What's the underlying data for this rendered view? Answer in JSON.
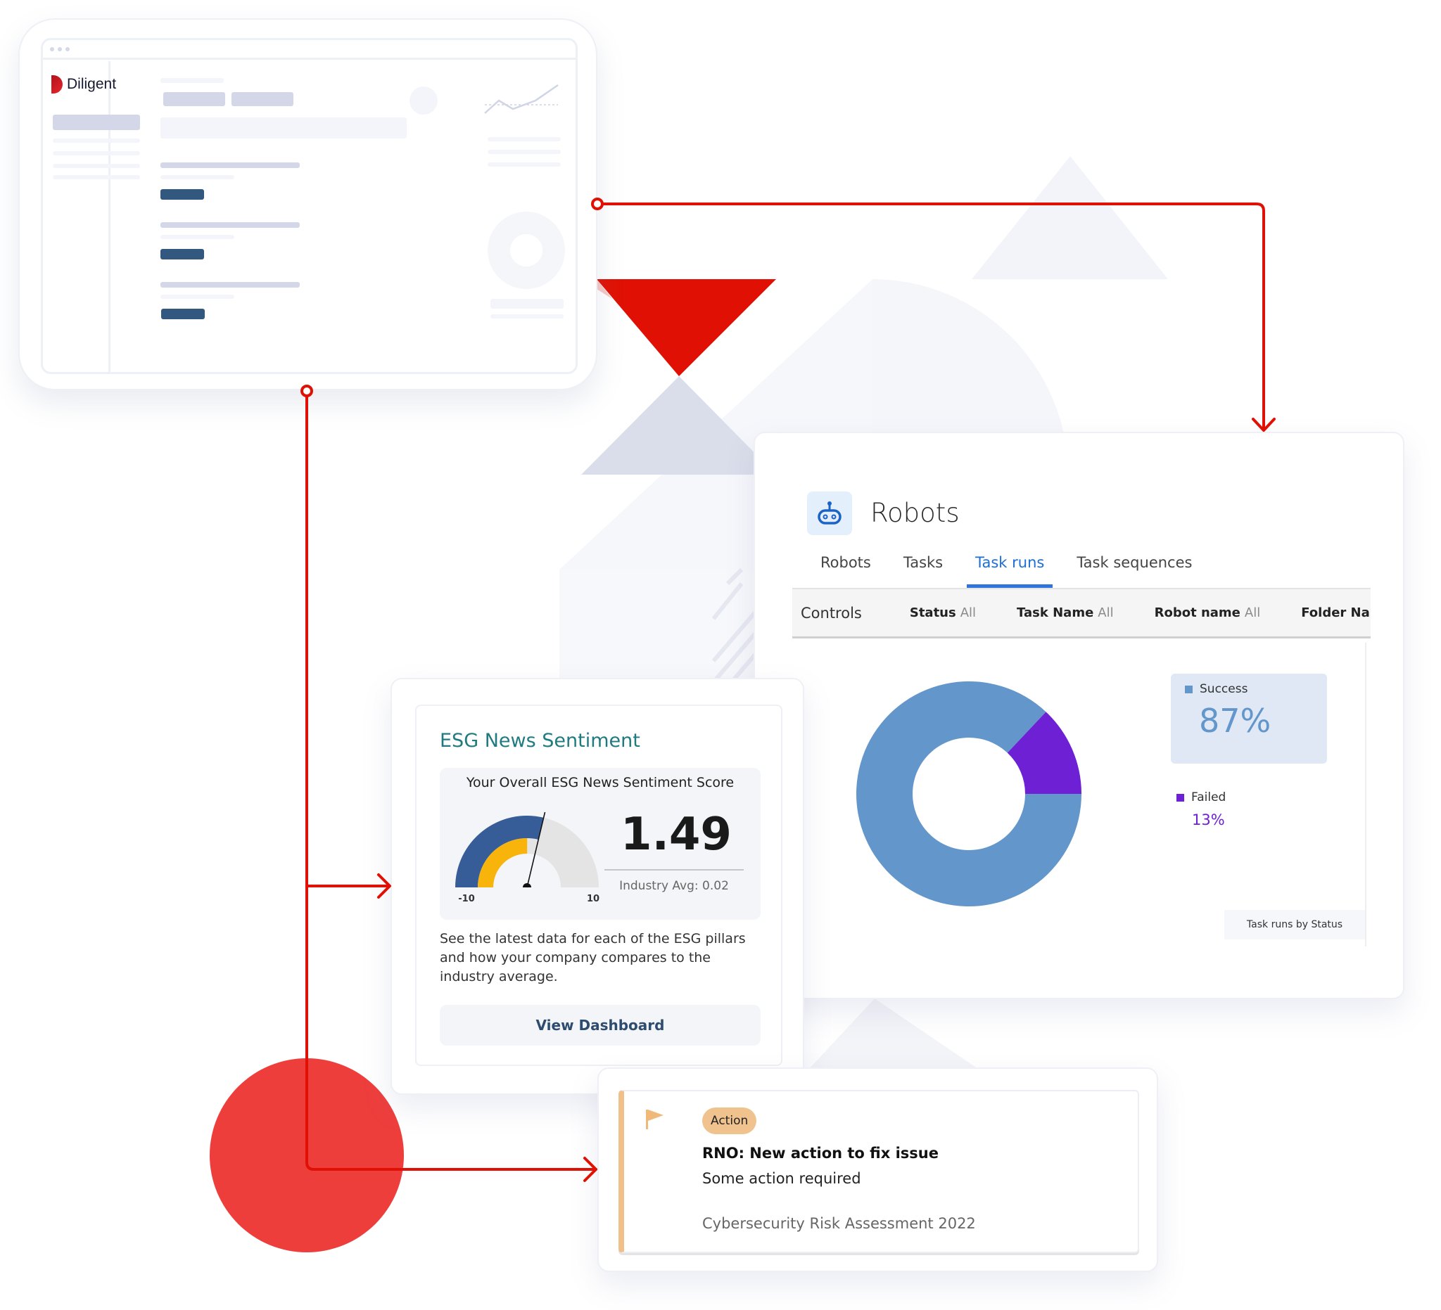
{
  "colors": {
    "accent_red": "#e01a10",
    "circle_red": "#ee3e3c",
    "success": "#6396cb",
    "failed": "#6e20d5",
    "tab_active": "#1b6fd6",
    "esg_title": "#1f7b80",
    "action_badge": "#f0c38e"
  },
  "mockup": {
    "logo_text": "Diligent"
  },
  "robots": {
    "title": "Robots",
    "icon": "robot-icon",
    "tabs": [
      {
        "label": "Robots",
        "active": false
      },
      {
        "label": "Tasks",
        "active": false
      },
      {
        "label": "Task runs",
        "active": true
      },
      {
        "label": "Task sequences",
        "active": false
      }
    ],
    "controls_label": "Controls",
    "filters": [
      {
        "name": "Status",
        "value": "All"
      },
      {
        "name": "Task Name",
        "value": "All"
      },
      {
        "name": "Robot name",
        "value": "All"
      },
      {
        "name": "Folder Name",
        "value": ""
      }
    ],
    "chart_caption": "Task runs by Status"
  },
  "chart_data": {
    "type": "pie",
    "title": "Task runs by Status",
    "donut": true,
    "categories": [
      "Success",
      "Failed"
    ],
    "values": [
      87,
      13
    ],
    "value_labels": [
      "87%",
      "13%"
    ],
    "colors": [
      "#6396cb",
      "#6e20d5"
    ],
    "legend": "right"
  },
  "esg": {
    "title": "ESG News Sentiment",
    "score_title": "Your Overall ESG News Sentiment Score",
    "score": "1.49",
    "gauge": {
      "min": -10,
      "max": 10,
      "value": 1.49,
      "industry_avg": 0.02,
      "min_label": "-10",
      "max_label": "10"
    },
    "industry_avg_label": "Industry Avg: 0.02",
    "description": "See the latest data for each of the ESG pillars and how your company compares to the industry average.",
    "button_label": "View Dashboard"
  },
  "action_card": {
    "badge": "Action",
    "title": "RNO: New action to fix issue",
    "subtitle": "Some action required",
    "meta": "Cybersecurity Risk Assessment 2022",
    "icon": "flag-icon"
  }
}
